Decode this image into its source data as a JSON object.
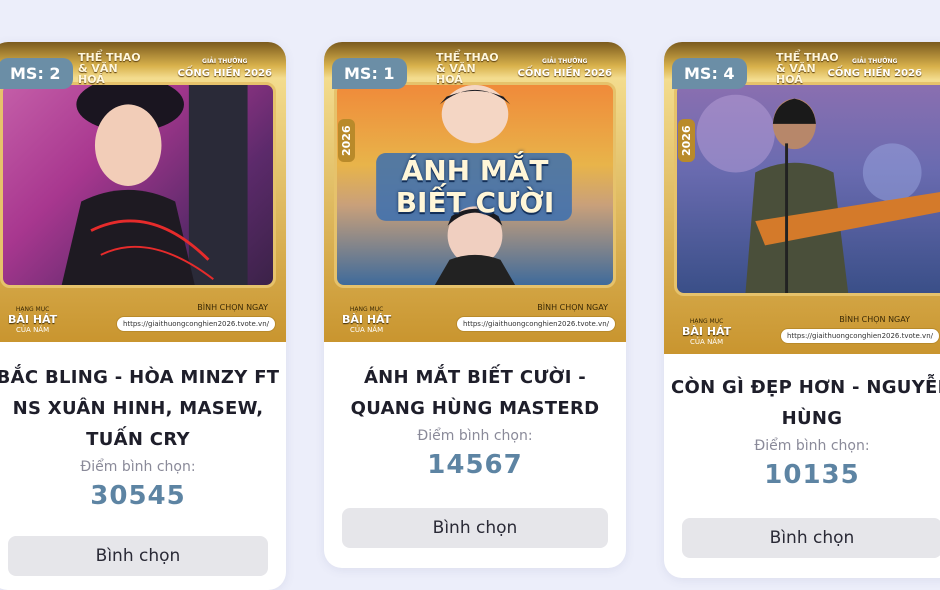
{
  "cards": [
    {
      "badge": "MS: 2",
      "brand": "THỂ THAO & VĂN HOÁ",
      "award": "CỐNG HIẾN 2026",
      "award_sub": "GIẢI THƯỞNG",
      "year": "2026",
      "category_small": "HẠNG MỤC",
      "category": "BÀI HÁT",
      "category_sub": "CỦA NĂM",
      "vote_now": "BÌNH CHỌN NGAY",
      "url": "https://giaithuongconghien2026.tvote.vn/",
      "title_lines": [
        "BẮC BLING - HÒA MINZY FT",
        "NS XUÂN HINH, MASEW,",
        "TUẤN CRY"
      ],
      "score_label": "Điểm bình chọn:",
      "score": "30545",
      "button": "Bình chọn"
    },
    {
      "badge": "MS: 1",
      "brand": "THỂ THAO & VĂN HOÁ",
      "award": "CỐNG HIẾN 2026",
      "award_sub": "GIẢI THƯỞNG",
      "year": "2026",
      "category_small": "HẠNG MỤC",
      "category": "BÀI HÁT",
      "category_sub": "CỦA NĂM",
      "vote_now": "BÌNH CHỌN NGAY",
      "url": "https://giaithuongconghien2026.tvote.vn/",
      "poster_text": [
        "ÁNH MẮT",
        "BIẾT CƯỜI"
      ],
      "title_lines": [
        "ÁNH MẮT BIẾT CƯỜI -",
        "QUANG HÙNG MASTERD"
      ],
      "score_label": "Điểm bình chọn:",
      "score": "14567",
      "button": "Bình chọn"
    },
    {
      "badge": "MS: 4",
      "brand": "THỂ THAO & VĂN HOÁ",
      "award": "CỐNG HIẾN 2026",
      "award_sub": "GIẢI THƯỞNG",
      "year": "2026",
      "category_small": "HẠNG MỤC",
      "category": "BÀI HÁT",
      "category_sub": "CỦA NĂM",
      "vote_now": "BÌNH CHỌN NGAY",
      "url": "https://giaithuongconghien2026.tvote.vn/",
      "title_lines": [
        "CÒN GÌ ĐẸP HƠN - NGUYỄN",
        "HÙNG"
      ],
      "score_label": "Điểm bình chọn:",
      "score": "10135",
      "button": "Bình chọn"
    }
  ]
}
